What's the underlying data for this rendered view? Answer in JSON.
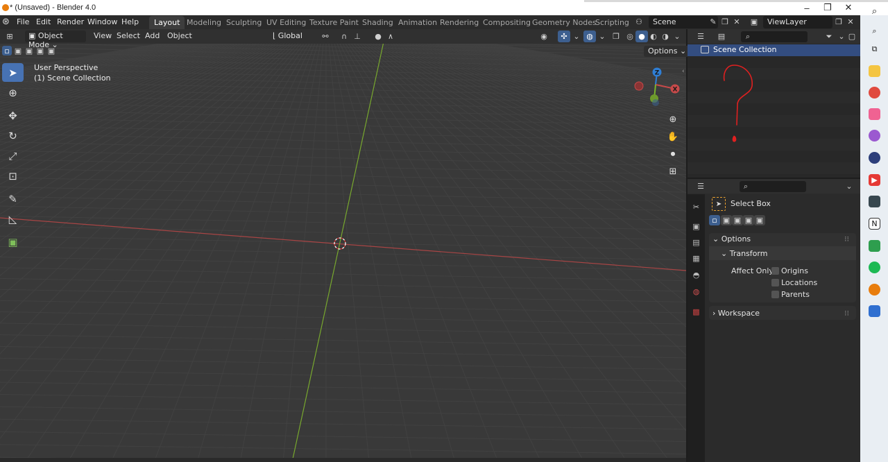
{
  "window": {
    "title": "* (Unsaved) - Blender 4.0",
    "minimize": "–",
    "maximize": "❐",
    "close": "✕"
  },
  "menu": [
    "File",
    "Edit",
    "Render",
    "Window",
    "Help"
  ],
  "workspaces": {
    "tabs": [
      "Layout",
      "Modeling",
      "Sculpting",
      "UV Editing",
      "Texture Paint",
      "Shading",
      "Animation",
      "Rendering",
      "Compositing",
      "Geometry Nodes",
      "Scripting"
    ],
    "active": "Layout"
  },
  "scene": {
    "name": "Scene",
    "view_layer": "ViewLayer"
  },
  "viewport_header": {
    "mode": "Object Mode",
    "menus": [
      "View",
      "Select",
      "Add",
      "Object"
    ],
    "orientation": "Global",
    "options_label": "Options"
  },
  "viewport_info": {
    "perspective": "User Perspective",
    "collection": "(1) Scene Collection"
  },
  "gizmo": {
    "z": "Z",
    "x": "X"
  },
  "outliner": {
    "root": "Scene Collection",
    "search_placeholder": ""
  },
  "properties": {
    "tool_name": "Select Box",
    "panels": {
      "options": "Options",
      "transform": "Transform",
      "affect_only": "Affect Only",
      "checkboxes": [
        "Origins",
        "Locations",
        "Parents"
      ],
      "workspace": "Workspace"
    }
  },
  "colors": {
    "accent": "#4772b3",
    "x_axis": "#c84a4a",
    "y_axis": "#7bb52c",
    "z_axis": "#2f7fd6",
    "annotation": "#e02020"
  },
  "icons": {
    "tools": [
      "select-box-icon",
      "cursor-icon",
      "move-icon",
      "rotate-icon",
      "scale-icon",
      "transform-icon",
      "annotate-icon",
      "measure-icon",
      "add-cube-icon"
    ],
    "nav": [
      "zoom-icon",
      "pan-hand-icon",
      "camera-icon",
      "grid-view-icon"
    ],
    "taskbar": [
      "search-icon",
      "task-view-icon",
      "file-explorer-icon",
      "chrome-icon",
      "app-icon",
      "photos-icon",
      "davinci-icon",
      "youtube-icon",
      "app-icon-2",
      "notion-icon",
      "app-icon-3",
      "spotify-icon",
      "blender-icon",
      "document-icon"
    ]
  }
}
